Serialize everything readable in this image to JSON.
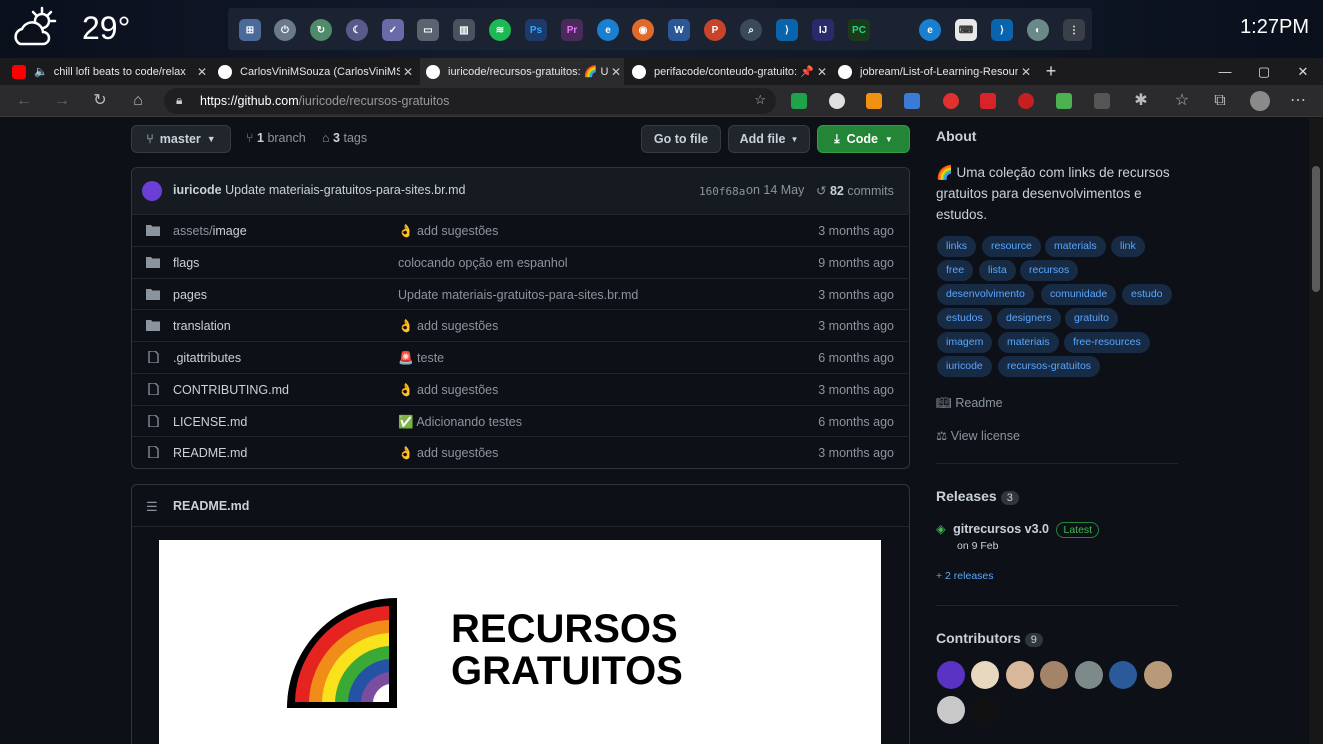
{
  "taskbar": {
    "temperature": "29°",
    "time": "1:27PM"
  },
  "tabs": [
    {
      "title": "chill lofi beats to code/relax",
      "active": false
    },
    {
      "title": "CarlosViniMSouza (CarlosViniMSouza)",
      "active": false
    },
    {
      "title": "iuricode/recursos-gratuitos: 🌈 Uma coleção",
      "active": true
    },
    {
      "title": "perifacode/conteudo-gratuito: 📌",
      "active": false
    },
    {
      "title": "jobream/List-of-Learning-Resources",
      "active": false
    }
  ],
  "address": {
    "host": "https://github.com",
    "path": "/iuricode/recursos-gratuitos"
  },
  "repo": {
    "branch_label": "master",
    "branch_count": "1",
    "branch_word": "branch",
    "tag_count": "3",
    "tag_word": "tags",
    "goto_file": "Go to file",
    "add_file": "Add file",
    "code": "Code",
    "commit": {
      "author": "iuricode",
      "message": "Update materiais-gratuitos-para-sites.br.md",
      "sha": "160f68a",
      "date": "on 14 May",
      "count": "82",
      "count_word": "commits"
    },
    "files": [
      {
        "name_prefix": "assets/",
        "name": "image",
        "type": "folder",
        "message": "👌 add sugestões",
        "age": "3 months ago"
      },
      {
        "name_prefix": "",
        "name": "flags",
        "type": "folder",
        "message": "colocando opção em espanhol",
        "age": "9 months ago"
      },
      {
        "name_prefix": "",
        "name": "pages",
        "type": "folder",
        "message": "Update materiais-gratuitos-para-sites.br.md",
        "age": "3 months ago"
      },
      {
        "name_prefix": "",
        "name": "translation",
        "type": "folder",
        "message": "👌 add sugestões",
        "age": "3 months ago"
      },
      {
        "name_prefix": "",
        "name": ".gitattributes",
        "type": "file",
        "message": "🚨 teste",
        "age": "6 months ago"
      },
      {
        "name_prefix": "",
        "name": "CONTRIBUTING.md",
        "type": "file",
        "message": "👌 add sugestões",
        "age": "3 months ago"
      },
      {
        "name_prefix": "",
        "name": "LICENSE.md",
        "type": "file",
        "message": "✅ Adicionando testes",
        "age": "6 months ago"
      },
      {
        "name_prefix": "",
        "name": "README.md",
        "type": "file",
        "message": "👌 add sugestões",
        "age": "3 months ago"
      }
    ],
    "readme_title": "README.md",
    "banner_line1": "RECURSOS",
    "banner_line2": "GRATUITOS"
  },
  "about": {
    "heading": "About",
    "description": "🌈 Uma coleção com links de recursos gratuitos para desenvolvimentos e estudos.",
    "topics": [
      "links",
      "resource",
      "materials",
      "link",
      "free",
      "lista",
      "recursos",
      "desenvolvimento",
      "comunidade",
      "estudo",
      "estudos",
      "designers",
      "gratuito",
      "imagem",
      "materiais",
      "free-resources",
      "iuricode",
      "recursos-gratuitos"
    ],
    "readme_link": "Readme",
    "license_link": "View license"
  },
  "releases": {
    "heading": "Releases",
    "count": "3",
    "latest_name": "gitrecursos v3.0",
    "latest_badge": "Latest",
    "latest_date": "on 9 Feb",
    "more": "+ 2 releases"
  },
  "contributors": {
    "heading": "Contributors",
    "count": "9"
  },
  "colors": {
    "accent": "#58a6ff",
    "green": "#238636",
    "bg": "#0d1117"
  }
}
